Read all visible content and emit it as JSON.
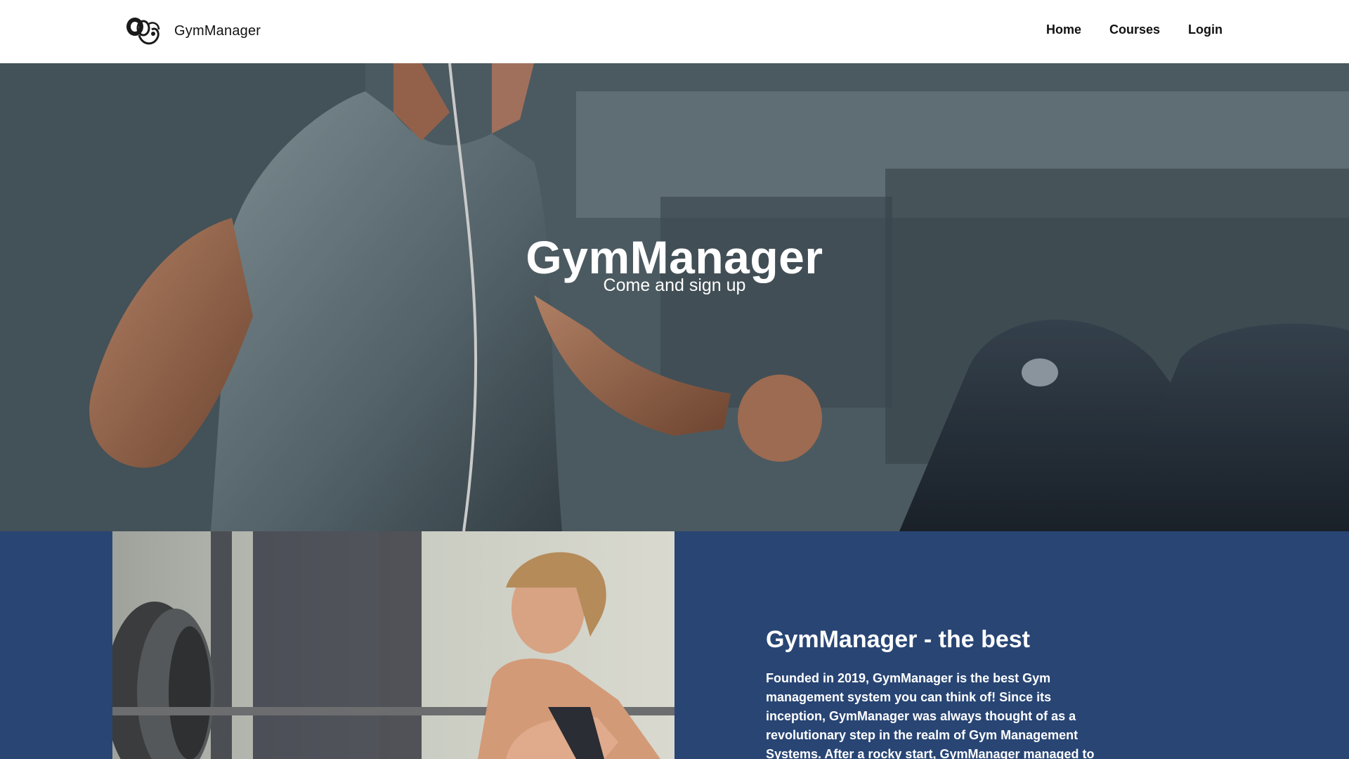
{
  "header": {
    "brand": "GymManager",
    "logo_icon": "gym-logo-icon",
    "nav": [
      {
        "label": "Home"
      },
      {
        "label": "Courses"
      },
      {
        "label": "Login"
      }
    ]
  },
  "hero": {
    "title": "GymManager",
    "subtitle": "Come and sign up",
    "image": "man-running-on-treadmill-photo"
  },
  "about": {
    "image": "woman-resting-on-barbell-photo",
    "heading": "GymManager - the best",
    "body": "Founded in 2019, GymManager is the best Gym management system you can think of! Since its inception, GymManager was always thought of as a revolutionary step in the realm of Gym Management Systems. After a rocky start, GymManager managed to"
  },
  "colors": {
    "header_bg": "#ffffff",
    "about_bg": "#284574",
    "text_light": "#ffffff",
    "text_dark": "#111111"
  }
}
